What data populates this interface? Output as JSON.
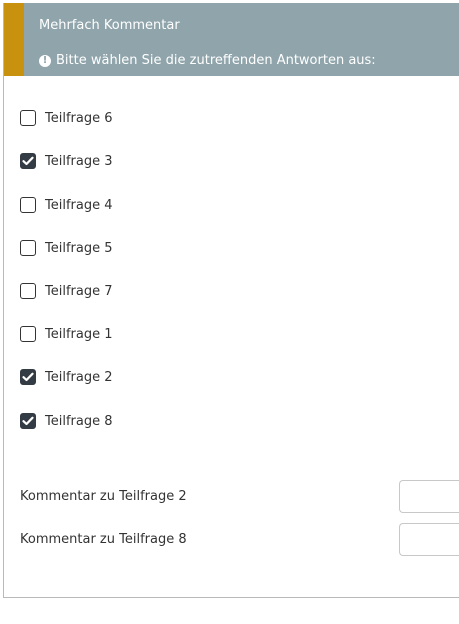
{
  "header": {
    "title": "Mehrfach Kommentar",
    "hint": "Bitte wählen Sie die zutreffenden Antworten aus:",
    "info_icon": "exclamation-circle-icon",
    "accent_color": "#c9920e",
    "background_color": "#8fa4ab"
  },
  "options": [
    {
      "label": "Teilfrage 6",
      "checked": false
    },
    {
      "label": "Teilfrage 3",
      "checked": true
    },
    {
      "label": "Teilfrage 4",
      "checked": false
    },
    {
      "label": "Teilfrage 5",
      "checked": false
    },
    {
      "label": "Teilfrage 7",
      "checked": false
    },
    {
      "label": "Teilfrage 1",
      "checked": false
    },
    {
      "label": "Teilfrage 2",
      "checked": true
    },
    {
      "label": "Teilfrage 8",
      "checked": true
    }
  ],
  "comments": [
    {
      "label": "Kommentar zu Teilfrage 2",
      "value": ""
    },
    {
      "label": "Kommentar zu Teilfrage 8",
      "value": ""
    }
  ]
}
